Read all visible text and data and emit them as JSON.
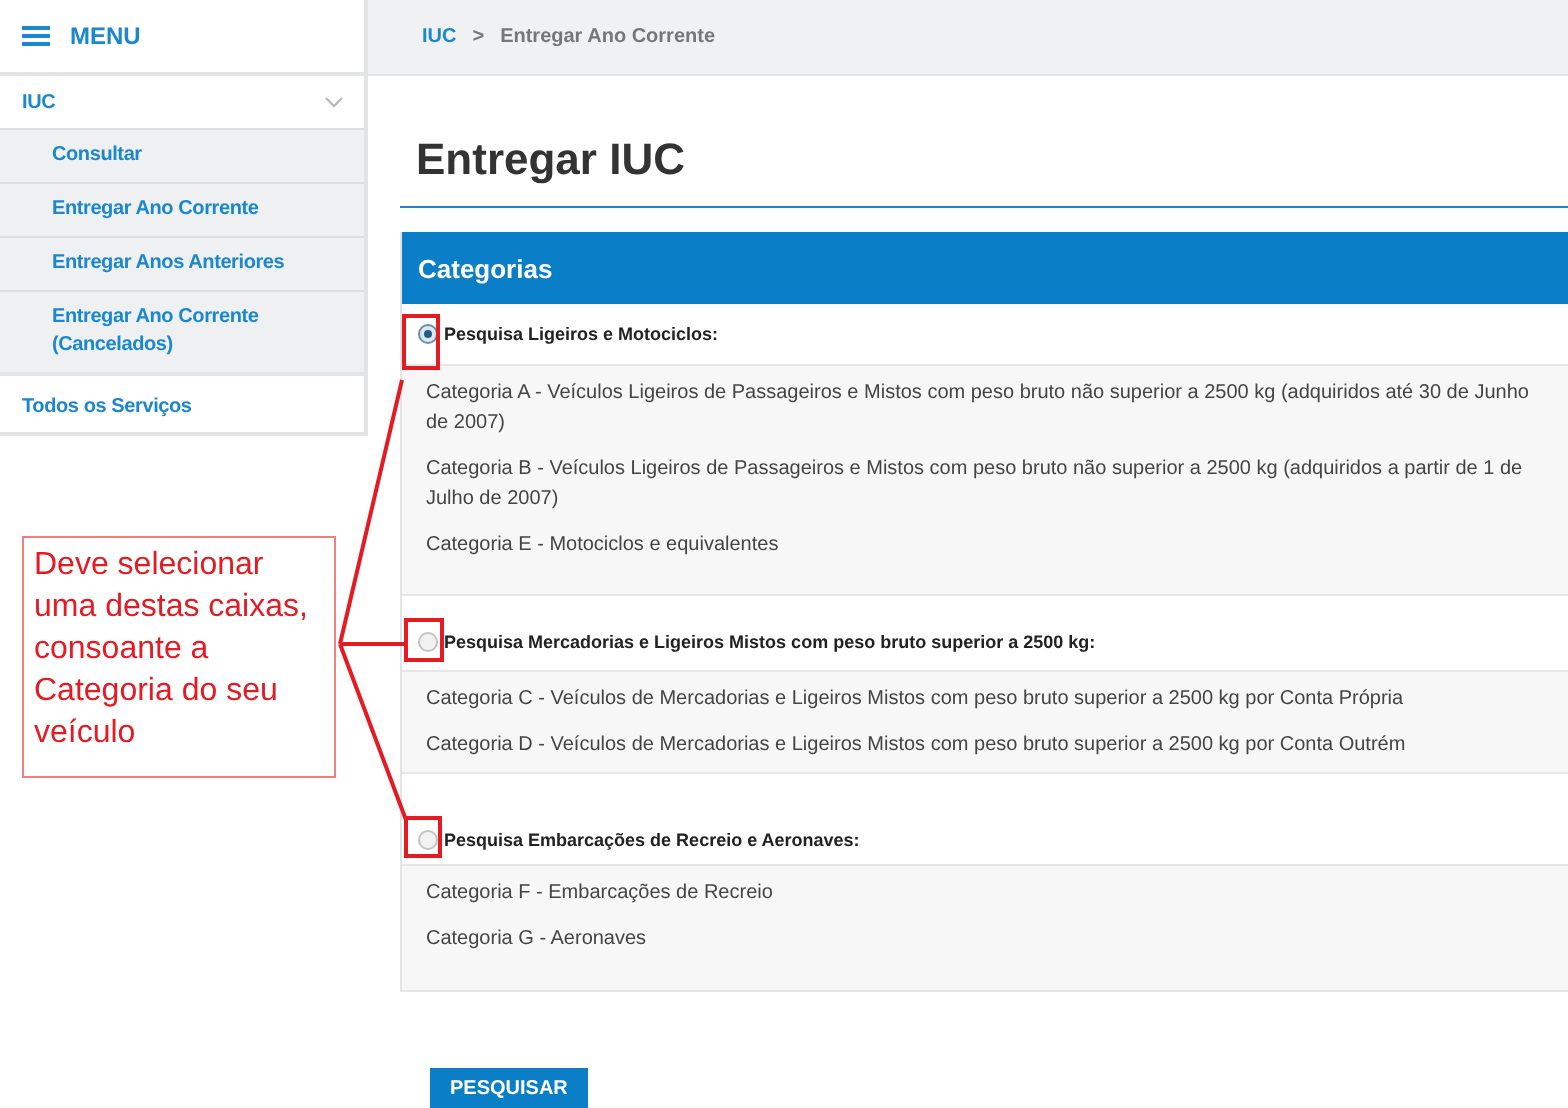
{
  "menu": {
    "label": "MENU"
  },
  "sidebar": {
    "items": [
      {
        "label": "IUC",
        "kind": "section",
        "expanded": true
      },
      {
        "label": "Consultar",
        "kind": "sub"
      },
      {
        "label": "Entregar Ano Corrente",
        "kind": "sub"
      },
      {
        "label": "Entregar Anos Anteriores",
        "kind": "sub"
      },
      {
        "label": "Entregar Ano Corrente (Cancelados)",
        "kind": "sub"
      },
      {
        "label": "Todos os Serviços",
        "kind": "section"
      }
    ]
  },
  "breadcrumb_separator": ">",
  "breadcrumb": [
    {
      "label": "IUC",
      "kind": "link"
    },
    {
      "label": "Entregar Ano Corrente",
      "kind": "current"
    }
  ],
  "title": "Entregar IUC",
  "panel": {
    "header": "Categorias",
    "groups": [
      {
        "label": "Pesquisa Ligeiros e Motociclos:",
        "selected": true,
        "options": [
          "Categoria A - Veículos Ligeiros de Passageiros e Mistos com peso bruto não superior a 2500 kg (adquiridos até 30 de Junho de 2007)",
          "Categoria B - Veículos Ligeiros de Passageiros e Mistos com peso bruto não superior a 2500 kg (adquiridos a partir de 1 de Julho de 2007)",
          "Categoria E - Motociclos e equivalentes"
        ]
      },
      {
        "label": "Pesquisa Mercadorias e Ligeiros Mistos com peso bruto superior a 2500 kg:",
        "selected": false,
        "options": [
          "Categoria C - Veículos de Mercadorias e Ligeiros Mistos com peso bruto superior a 2500 kg por Conta Própria",
          "Categoria D - Veículos de Mercadorias e Ligeiros Mistos com peso bruto superior a 2500 kg por Conta Outrém"
        ]
      },
      {
        "label": "Pesquisa Embarcações de Recreio e Aeronaves:",
        "selected": false,
        "options": [
          "Categoria F - Embarcações de Recreio",
          "Categoria G - Aeronaves"
        ]
      }
    ]
  },
  "button": "PESQUISAR",
  "callout": {
    "text": "Deve selecionar uma destas caixas, consoante a Categoria do seu veículo"
  }
}
